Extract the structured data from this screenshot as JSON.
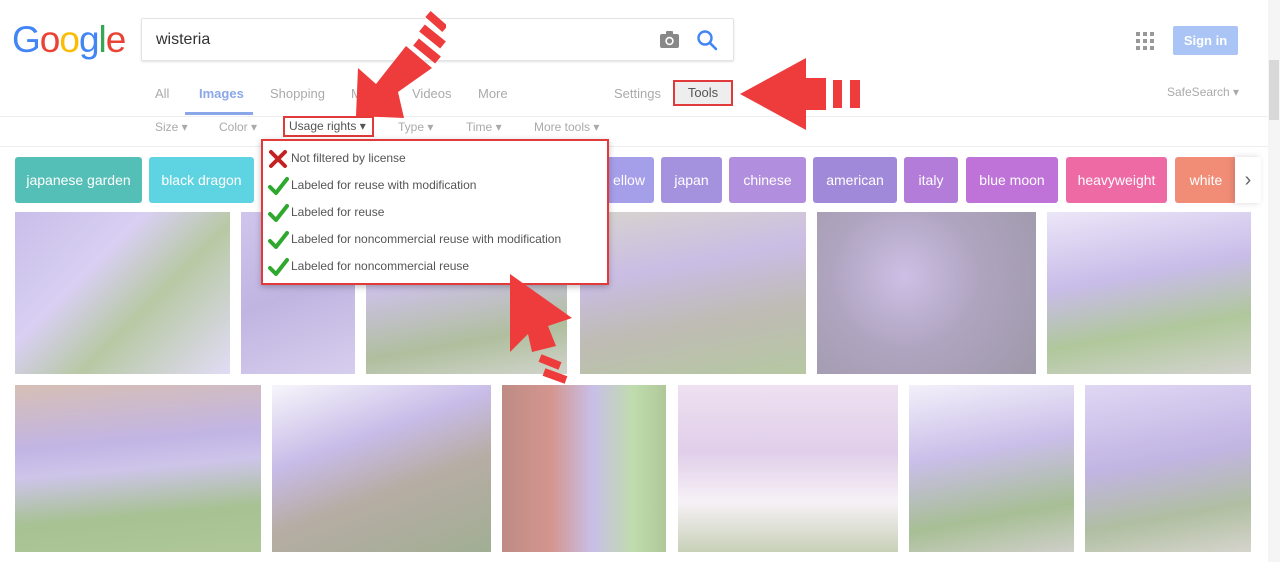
{
  "logo": {
    "letters": [
      "G",
      "o",
      "o",
      "g",
      "l",
      "e"
    ]
  },
  "search": {
    "query": "wisteria"
  },
  "header": {
    "sign_in": "Sign in"
  },
  "tabs": [
    {
      "label": "All",
      "active": false
    },
    {
      "label": "Images",
      "active": true
    },
    {
      "label": "Shopping",
      "active": false
    },
    {
      "label": "M",
      "active": false
    },
    {
      "label": "Videos",
      "active": false
    },
    {
      "label": "More",
      "active": false
    }
  ],
  "settings_label": "Settings",
  "tools_label": "Tools",
  "safesearch_label": "SafeSearch",
  "filters": {
    "size": "Size",
    "color": "Color",
    "usage_rights": "Usage rights",
    "type": "Type",
    "time": "Time",
    "more_tools": "More tools"
  },
  "usage_menu": [
    {
      "label": "Not filtered by license",
      "icon": "red-x-icon"
    },
    {
      "label": "Labeled for reuse with modification",
      "icon": "green-check-icon"
    },
    {
      "label": "Labeled for reuse",
      "icon": "green-check-icon"
    },
    {
      "label": "Labeled for noncommercial reuse with modification",
      "icon": "green-check-icon"
    },
    {
      "label": "Labeled for noncommercial reuse",
      "icon": "green-check-icon"
    }
  ],
  "chips": [
    {
      "label": "japanese garden",
      "color": "#2ab0a4"
    },
    {
      "label": "black dragon",
      "color": "#36c9dc"
    },
    {
      "label": "ellow",
      "color": "#8f86e3"
    },
    {
      "label": "japan",
      "color": "#8f78d6"
    },
    {
      "label": "chinese",
      "color": "#9f72d6"
    },
    {
      "label": "american",
      "color": "#8a6cd0"
    },
    {
      "label": "italy",
      "color": "#a05ccf"
    },
    {
      "label": "blue moon",
      "color": "#b04fcf"
    },
    {
      "label": "heavyweight",
      "color": "#e9468f"
    },
    {
      "label": "white",
      "color": "#ee7156"
    }
  ],
  "colors": {
    "accent_red": "#e03a3a",
    "link_blue": "#8aa8e8"
  }
}
